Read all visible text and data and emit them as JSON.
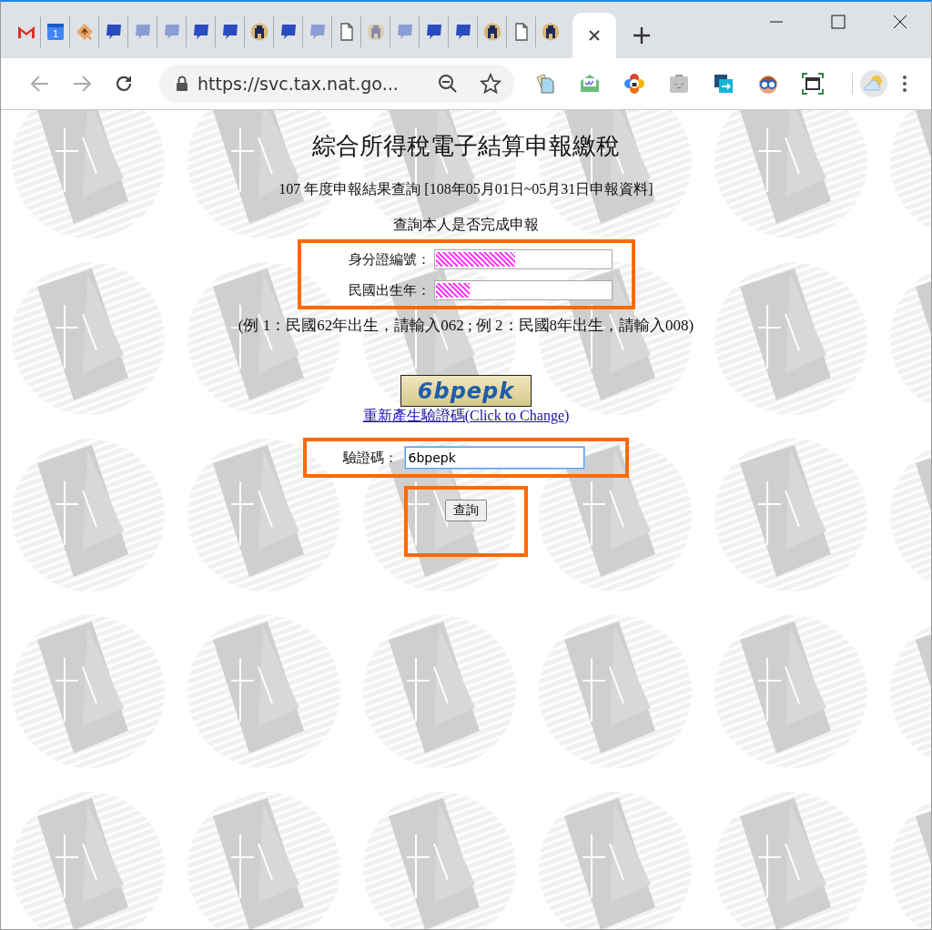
{
  "browser": {
    "tabs": [
      {
        "kind": "gmail",
        "dimmed": false,
        "selected": false
      },
      {
        "kind": "calendar",
        "icon_text": "1",
        "dimmed": false,
        "selected": false
      },
      {
        "kind": "puzzle",
        "dimmed": false,
        "selected": false
      },
      {
        "kind": "chat",
        "dimmed": false,
        "selected": false
      },
      {
        "kind": "chat",
        "dimmed": true,
        "selected": false
      },
      {
        "kind": "chat",
        "dimmed": true,
        "selected": false
      },
      {
        "kind": "chat",
        "dimmed": false,
        "selected": false
      },
      {
        "kind": "chat",
        "dimmed": false,
        "selected": false
      },
      {
        "kind": "seal",
        "dimmed": false,
        "selected": false
      },
      {
        "kind": "chat",
        "dimmed": false,
        "selected": false
      },
      {
        "kind": "chat",
        "dimmed": true,
        "selected": false
      },
      {
        "kind": "doc",
        "dimmed": false,
        "selected": false
      },
      {
        "kind": "seal",
        "dimmed": true,
        "selected": false
      },
      {
        "kind": "chat",
        "dimmed": true,
        "selected": false
      },
      {
        "kind": "chat",
        "dimmed": false,
        "selected": false
      },
      {
        "kind": "chat",
        "dimmed": false,
        "selected": false
      },
      {
        "kind": "seal",
        "dimmed": false,
        "selected": false
      },
      {
        "kind": "doc",
        "dimmed": false,
        "selected": false
      },
      {
        "kind": "seal",
        "dimmed": false,
        "selected": false
      },
      {
        "kind": "blank",
        "selected": true
      }
    ],
    "address": "https://svc.tax.nat.go...",
    "extensions": [
      {
        "kind": "papers"
      },
      {
        "kind": "mail"
      },
      {
        "kind": "flower"
      },
      {
        "kind": "sleepy"
      },
      {
        "kind": "share"
      },
      {
        "kind": "goggles"
      },
      {
        "kind": "screenshot"
      }
    ]
  },
  "page": {
    "title": "綜合所得稅電子結算申報繳稅",
    "subtitle": "107 年度申報結果查詢 [108年05月01日~05月31日申報資料]",
    "query_label": "查詢本人是否完成申報",
    "fields": [
      {
        "label": "身分證編號：",
        "masked": true,
        "level": 0.45
      },
      {
        "label": "民國出生年：",
        "masked": true,
        "level": 0.19
      }
    ],
    "example_note": "(例 1：民國62年出生，請輸入062 ; 例 2：民國8年出生，請輸入008)",
    "captcha": {
      "text": "6bpepk"
    },
    "refresh_link": "重新產生驗證碼(Click to Change)",
    "code_field": {
      "label": "驗證碼：",
      "value": "6bpepk",
      "focused": true
    },
    "submit": "查詢"
  }
}
